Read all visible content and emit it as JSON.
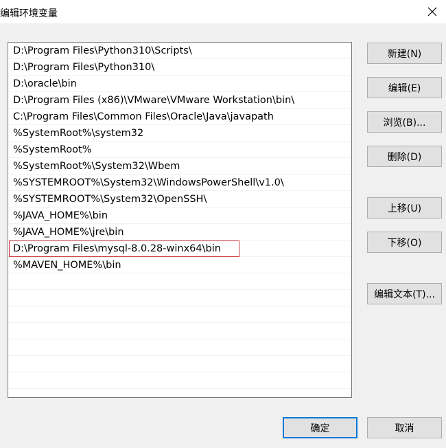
{
  "window": {
    "title": "编辑环境变量",
    "close_icon": "close-icon"
  },
  "list": {
    "items": [
      "D:\\Program Files\\Python310\\Scripts\\",
      "D:\\Program Files\\Python310\\",
      "D:\\oracle\\bin",
      "D:\\Program Files (x86)\\VMware\\VMware Workstation\\bin\\",
      "C:\\Program Files\\Common Files\\Oracle\\Java\\javapath",
      "%SystemRoot%\\system32",
      "%SystemRoot%",
      "%SystemRoot%\\System32\\Wbem",
      "%SYSTEMROOT%\\System32\\WindowsPowerShell\\v1.0\\",
      "%SYSTEMROOT%\\System32\\OpenSSH\\",
      "%JAVA_HOME%\\bin",
      "%JAVA_HOME%\\jre\\bin",
      "D:\\Program Files\\mysql-8.0.28-winx64\\bin",
      "%MAVEN_HOME%\\bin"
    ],
    "highlighted_index": 12,
    "highlight_color": "#d0383c"
  },
  "buttons": {
    "new": "新建(N)",
    "edit": "编辑(E)",
    "browse": "浏览(B)...",
    "delete": "删除(D)",
    "move_up": "上移(U)",
    "move_down": "下移(O)",
    "edit_text": "编辑文本(T)...",
    "ok": "确定",
    "cancel": "取消"
  },
  "colors": {
    "accent": "#0078d7"
  }
}
